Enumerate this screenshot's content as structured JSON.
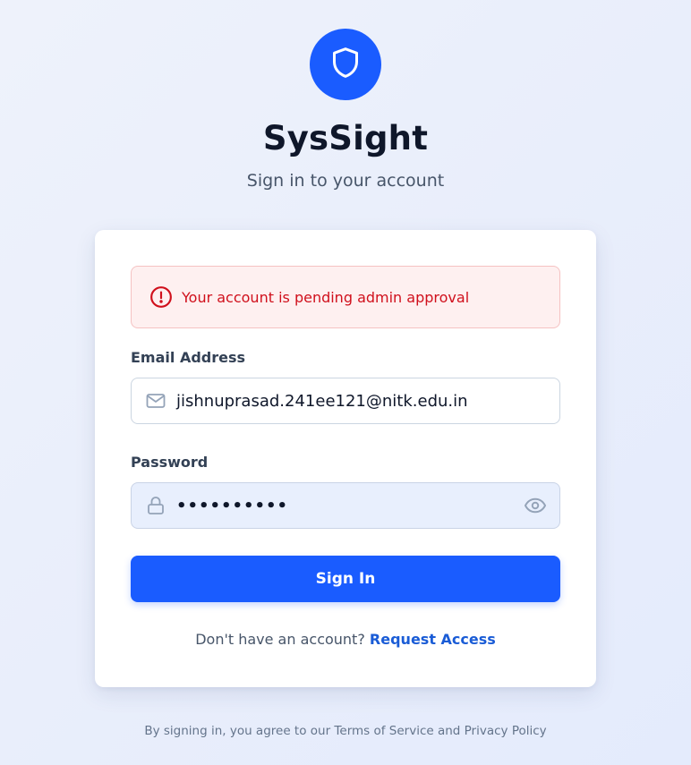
{
  "brand": {
    "title": "SysSight",
    "subtitle": "Sign in to your account",
    "logo_icon": "shield-icon",
    "accent_color": "#1a5cff"
  },
  "alert": {
    "icon": "alert-circle-icon",
    "message": "Your account is pending admin approval",
    "color": "#d0101c"
  },
  "form": {
    "email": {
      "label": "Email Address",
      "icon": "mail-icon",
      "value": "jishnuprasad.241ee121@nitk.edu.in"
    },
    "password": {
      "label": "Password",
      "icon": "lock-icon",
      "masked_value": "••••••••••",
      "toggle_icon": "eye-icon"
    },
    "submit_label": "Sign In"
  },
  "request_access": {
    "prompt": "Don't have an account?",
    "link_label": "Request Access"
  },
  "footer": {
    "text": "By signing in, you agree to our Terms of Service and Privacy Policy"
  }
}
